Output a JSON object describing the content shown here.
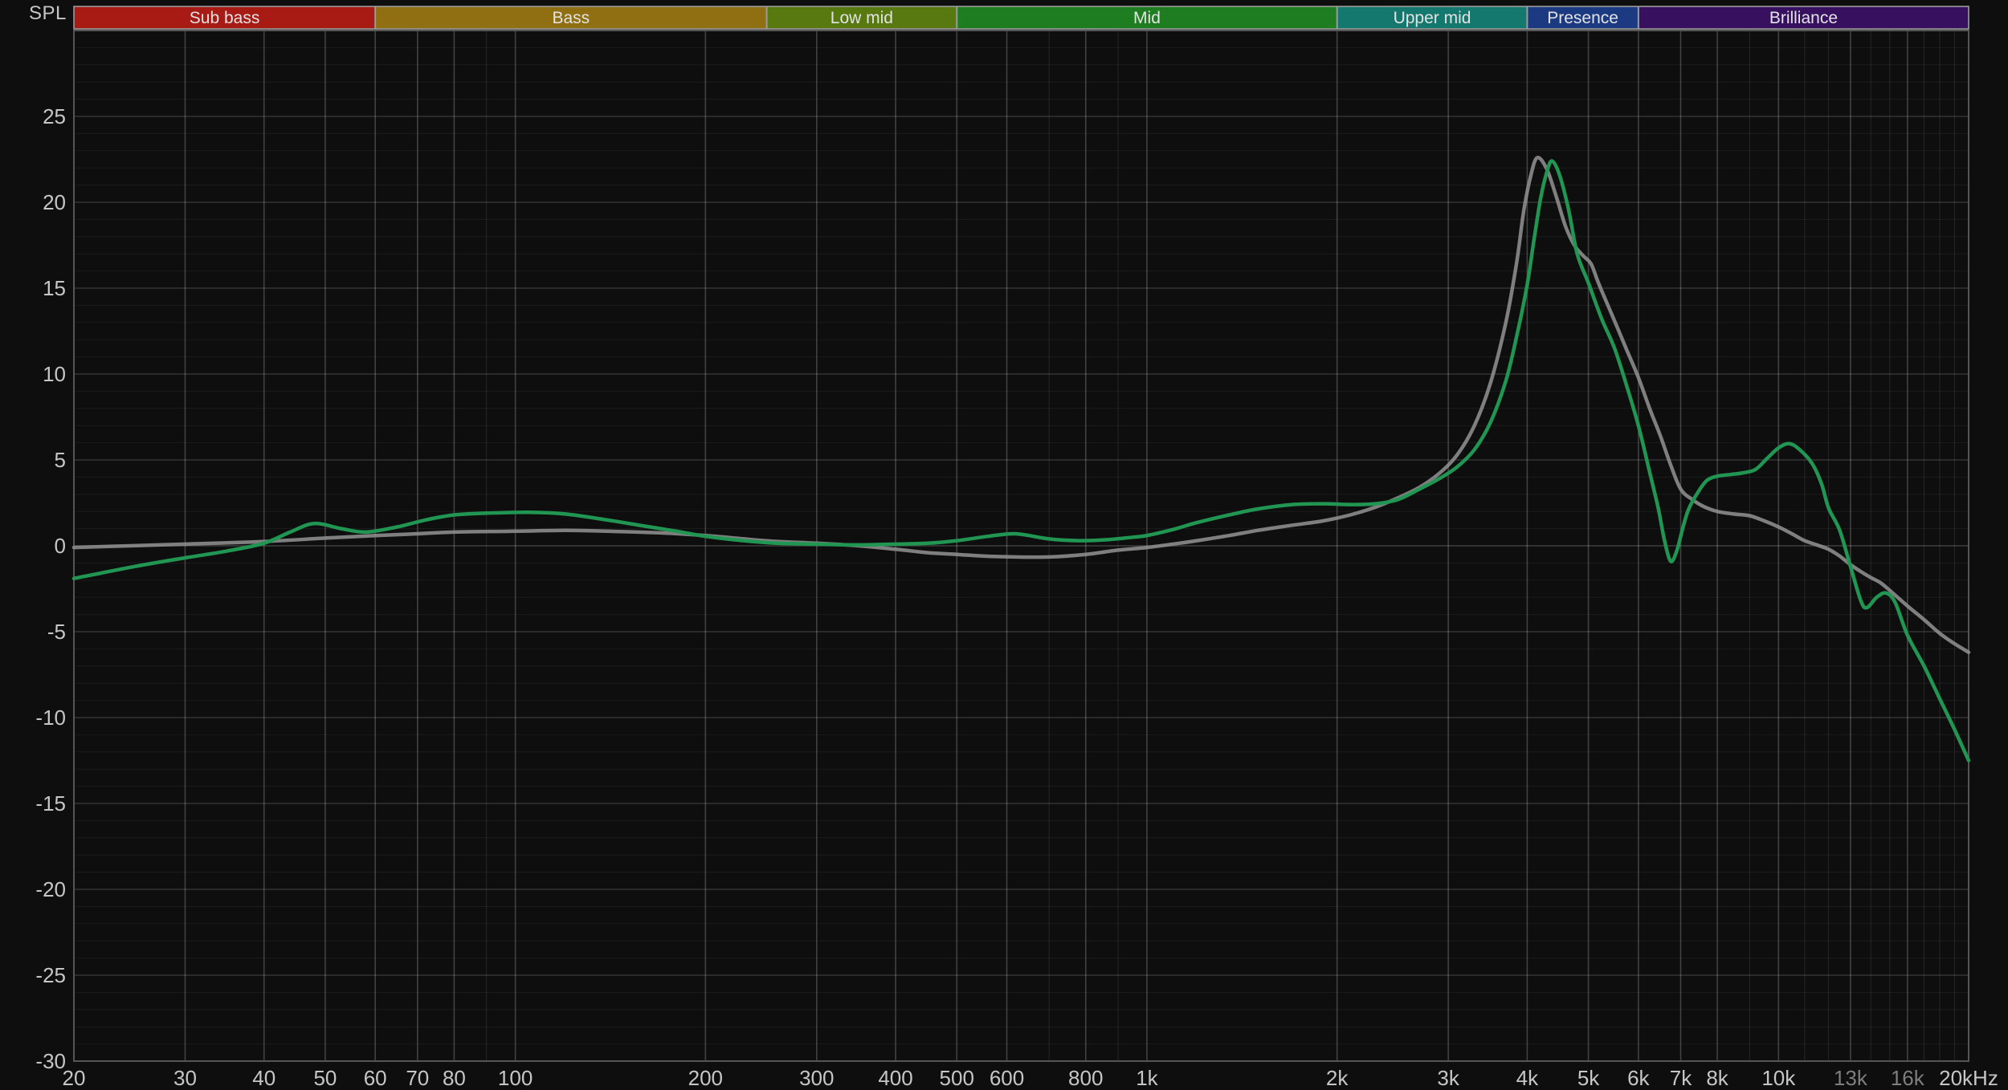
{
  "ylabel": "SPL",
  "colors": {
    "background": "#0e0e0e",
    "axis_border": "#555555",
    "grid_minor": "rgba(255,255,255,0.06)",
    "grid_major": "rgba(255,255,255,0.16)",
    "grid_zero": "rgba(255,255,255,0.20)",
    "grid_step": "rgba(255,255,255,0.10)",
    "grid_labeled": "rgba(255,255,255,0.21)",
    "tick_label": "#c6c6c6",
    "tick_label_dim": "#7e7e7e",
    "band_text": "#e3e3e3",
    "band_border": "#9b9b9b",
    "series_green": "#219653",
    "series_gray": "#909090"
  },
  "bands": [
    {
      "label": "Sub bass",
      "from": 20,
      "to": 60,
      "color": "#a81b15"
    },
    {
      "label": "Bass",
      "from": 60,
      "to": 250,
      "color": "#8f6f12"
    },
    {
      "label": "Low mid",
      "from": 250,
      "to": 500,
      "color": "#57790f"
    },
    {
      "label": "Mid",
      "from": 500,
      "to": 2000,
      "color": "#1f7d21"
    },
    {
      "label": "Upper mid",
      "from": 2000,
      "to": 4000,
      "color": "#14786e"
    },
    {
      "label": "Presence",
      "from": 4000,
      "to": 6000,
      "color": "#1c3a82"
    },
    {
      "label": "Brilliance",
      "from": 6000,
      "to": 20000,
      "color": "#371060"
    }
  ],
  "chart_data": {
    "type": "line",
    "x_scale": "log",
    "x_range": [
      20,
      20000
    ],
    "y_range": [
      -30,
      30
    ],
    "grid": "on",
    "legend": "none",
    "y_ticks": [
      25,
      20,
      15,
      10,
      5,
      0,
      -5,
      -10,
      -15,
      -20,
      -25,
      -30
    ],
    "x_grid_lines": [
      20,
      30,
      40,
      50,
      60,
      70,
      80,
      90,
      100,
      200,
      300,
      400,
      500,
      600,
      700,
      800,
      900,
      1000,
      2000,
      3000,
      4000,
      5000,
      6000,
      7000,
      8000,
      9000,
      10000,
      11000,
      12000,
      13000,
      14000,
      15000,
      16000,
      17000,
      18000,
      19000,
      20000
    ],
    "x_ticks": [
      {
        "f": 20,
        "label": "20"
      },
      {
        "f": 30,
        "label": "30"
      },
      {
        "f": 40,
        "label": "40"
      },
      {
        "f": 50,
        "label": "50"
      },
      {
        "f": 60,
        "label": "60"
      },
      {
        "f": 70,
        "label": "70"
      },
      {
        "f": 80,
        "label": "80"
      },
      {
        "f": 100,
        "label": "100"
      },
      {
        "f": 200,
        "label": "200"
      },
      {
        "f": 300,
        "label": "300"
      },
      {
        "f": 400,
        "label": "400"
      },
      {
        "f": 500,
        "label": "500"
      },
      {
        "f": 600,
        "label": "600"
      },
      {
        "f": 800,
        "label": "800"
      },
      {
        "f": 1000,
        "label": "1k"
      },
      {
        "f": 2000,
        "label": "2k"
      },
      {
        "f": 3000,
        "label": "3k"
      },
      {
        "f": 4000,
        "label": "4k"
      },
      {
        "f": 5000,
        "label": "5k"
      },
      {
        "f": 6000,
        "label": "6k"
      },
      {
        "f": 7000,
        "label": "7k"
      },
      {
        "f": 8000,
        "label": "8k"
      },
      {
        "f": 10000,
        "label": "10k"
      },
      {
        "f": 13000,
        "label": "13k",
        "dim": true
      },
      {
        "f": 16000,
        "label": "16k",
        "dim": true
      },
      {
        "f": 20000,
        "label": "20kHz"
      }
    ],
    "series": [
      {
        "name": "gray",
        "color_key": "series_gray",
        "width": 4.5,
        "opacity": 0.88,
        "points": [
          [
            20,
            -0.1
          ],
          [
            30,
            0.1
          ],
          [
            40,
            0.25
          ],
          [
            50,
            0.45
          ],
          [
            60,
            0.6
          ],
          [
            70,
            0.7
          ],
          [
            80,
            0.8
          ],
          [
            100,
            0.85
          ],
          [
            120,
            0.9
          ],
          [
            140,
            0.85
          ],
          [
            170,
            0.75
          ],
          [
            200,
            0.6
          ],
          [
            230,
            0.4
          ],
          [
            260,
            0.25
          ],
          [
            300,
            0.15
          ],
          [
            350,
            0.0
          ],
          [
            400,
            -0.2
          ],
          [
            450,
            -0.4
          ],
          [
            500,
            -0.5
          ],
          [
            550,
            -0.6
          ],
          [
            620,
            -0.65
          ],
          [
            700,
            -0.65
          ],
          [
            800,
            -0.5
          ],
          [
            900,
            -0.25
          ],
          [
            1000,
            -0.1
          ],
          [
            1100,
            0.1
          ],
          [
            1200,
            0.3
          ],
          [
            1350,
            0.6
          ],
          [
            1500,
            0.9
          ],
          [
            1700,
            1.2
          ],
          [
            1900,
            1.45
          ],
          [
            2100,
            1.8
          ],
          [
            2300,
            2.25
          ],
          [
            2500,
            2.8
          ],
          [
            2700,
            3.4
          ],
          [
            2900,
            4.2
          ],
          [
            3100,
            5.3
          ],
          [
            3300,
            7.0
          ],
          [
            3500,
            9.5
          ],
          [
            3700,
            13.0
          ],
          [
            3850,
            16.5
          ],
          [
            3950,
            19.5
          ],
          [
            4050,
            21.5
          ],
          [
            4150,
            22.6
          ],
          [
            4300,
            21.9
          ],
          [
            4450,
            20.3
          ],
          [
            4600,
            18.6
          ],
          [
            4750,
            17.5
          ],
          [
            4900,
            16.9
          ],
          [
            5050,
            16.4
          ],
          [
            5200,
            15.2
          ],
          [
            5500,
            13.1
          ],
          [
            5750,
            11.4
          ],
          [
            6000,
            9.8
          ],
          [
            6250,
            8.0
          ],
          [
            6500,
            6.4
          ],
          [
            6750,
            4.7
          ],
          [
            7000,
            3.3
          ],
          [
            7300,
            2.7
          ],
          [
            7600,
            2.3
          ],
          [
            8000,
            2.0
          ],
          [
            8500,
            1.85
          ],
          [
            9000,
            1.75
          ],
          [
            9500,
            1.45
          ],
          [
            10000,
            1.1
          ],
          [
            10500,
            0.7
          ],
          [
            11000,
            0.3
          ],
          [
            11500,
            0.05
          ],
          [
            12000,
            -0.2
          ],
          [
            12500,
            -0.6
          ],
          [
            13000,
            -1.1
          ],
          [
            13500,
            -1.5
          ],
          [
            14000,
            -1.85
          ],
          [
            14500,
            -2.15
          ],
          [
            15000,
            -2.6
          ],
          [
            16000,
            -3.5
          ],
          [
            17000,
            -4.3
          ],
          [
            18000,
            -5.1
          ],
          [
            19000,
            -5.7
          ],
          [
            20000,
            -6.2
          ]
        ]
      },
      {
        "name": "green",
        "color_key": "series_green",
        "width": 4.5,
        "opacity": 1,
        "points": [
          [
            20,
            -1.9
          ],
          [
            25,
            -1.2
          ],
          [
            30,
            -0.7
          ],
          [
            35,
            -0.3
          ],
          [
            40,
            0.15
          ],
          [
            44,
            0.8
          ],
          [
            48,
            1.3
          ],
          [
            53,
            1.0
          ],
          [
            58,
            0.8
          ],
          [
            65,
            1.1
          ],
          [
            72,
            1.5
          ],
          [
            80,
            1.8
          ],
          [
            90,
            1.9
          ],
          [
            105,
            1.95
          ],
          [
            120,
            1.85
          ],
          [
            140,
            1.5
          ],
          [
            160,
            1.15
          ],
          [
            180,
            0.85
          ],
          [
            200,
            0.55
          ],
          [
            230,
            0.3
          ],
          [
            260,
            0.15
          ],
          [
            300,
            0.1
          ],
          [
            350,
            0.05
          ],
          [
            400,
            0.1
          ],
          [
            450,
            0.15
          ],
          [
            500,
            0.3
          ],
          [
            560,
            0.55
          ],
          [
            620,
            0.7
          ],
          [
            700,
            0.4
          ],
          [
            780,
            0.3
          ],
          [
            860,
            0.35
          ],
          [
            950,
            0.5
          ],
          [
            1000,
            0.6
          ],
          [
            1100,
            0.95
          ],
          [
            1200,
            1.35
          ],
          [
            1350,
            1.8
          ],
          [
            1500,
            2.15
          ],
          [
            1700,
            2.4
          ],
          [
            1900,
            2.45
          ],
          [
            2100,
            2.4
          ],
          [
            2300,
            2.45
          ],
          [
            2500,
            2.7
          ],
          [
            2700,
            3.3
          ],
          [
            2900,
            3.9
          ],
          [
            3100,
            4.6
          ],
          [
            3300,
            5.6
          ],
          [
            3500,
            7.2
          ],
          [
            3700,
            9.6
          ],
          [
            3850,
            12.2
          ],
          [
            4000,
            15.2
          ],
          [
            4100,
            17.8
          ],
          [
            4200,
            20.2
          ],
          [
            4300,
            21.8
          ],
          [
            4380,
            22.4
          ],
          [
            4500,
            21.6
          ],
          [
            4650,
            19.6
          ],
          [
            4800,
            17.0
          ],
          [
            5000,
            15.3
          ],
          [
            5250,
            13.2
          ],
          [
            5500,
            11.5
          ],
          [
            5750,
            9.3
          ],
          [
            6000,
            7.0
          ],
          [
            6250,
            4.3
          ],
          [
            6450,
            2.2
          ],
          [
            6600,
            0.3
          ],
          [
            6750,
            -0.9
          ],
          [
            6900,
            -0.3
          ],
          [
            7050,
            1.0
          ],
          [
            7200,
            2.1
          ],
          [
            7450,
            3.1
          ],
          [
            7700,
            3.8
          ],
          [
            8000,
            4.05
          ],
          [
            8400,
            4.15
          ],
          [
            8800,
            4.25
          ],
          [
            9200,
            4.45
          ],
          [
            9600,
            5.1
          ],
          [
            10000,
            5.7
          ],
          [
            10400,
            5.95
          ],
          [
            10800,
            5.6
          ],
          [
            11300,
            4.8
          ],
          [
            11700,
            3.6
          ],
          [
            12000,
            2.2
          ],
          [
            12500,
            0.9
          ],
          [
            13000,
            -1.2
          ],
          [
            13500,
            -3.2
          ],
          [
            13800,
            -3.6
          ],
          [
            14300,
            -3.0
          ],
          [
            14800,
            -2.75
          ],
          [
            15300,
            -3.3
          ],
          [
            16000,
            -5.2
          ],
          [
            17000,
            -7.0
          ],
          [
            18000,
            -8.9
          ],
          [
            19000,
            -10.7
          ],
          [
            20000,
            -12.5
          ]
        ]
      }
    ]
  }
}
